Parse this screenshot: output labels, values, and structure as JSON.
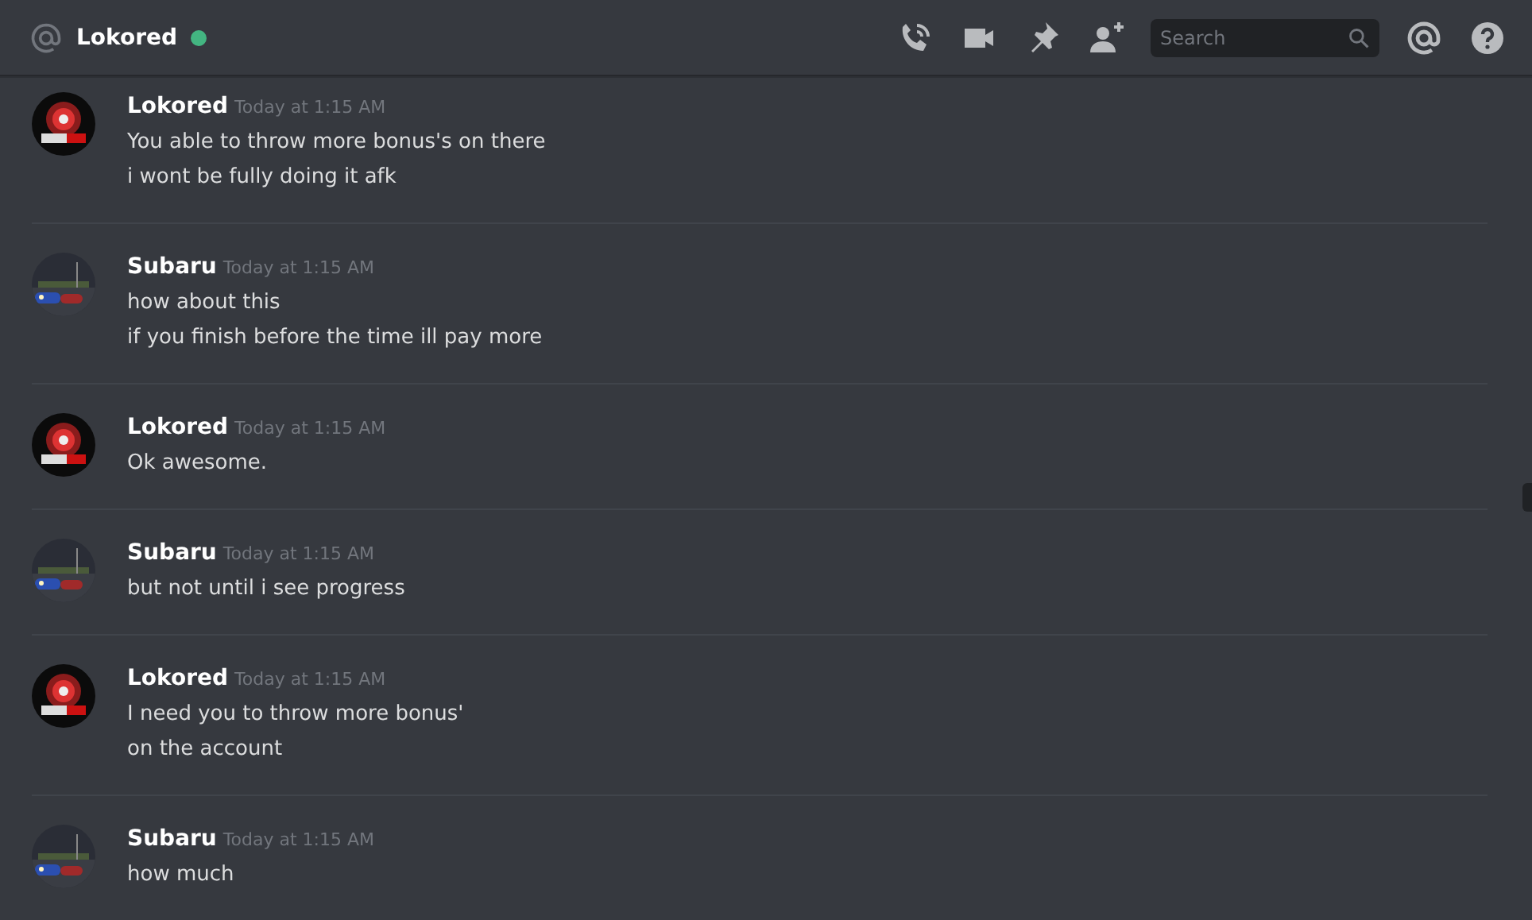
{
  "header": {
    "title": "Lokored",
    "online": true,
    "search": {
      "placeholder": "Search"
    }
  },
  "messages": [
    {
      "author": "Lokored",
      "kind": "logo",
      "time": "Today at 1:15 AM",
      "lines": [
        "You able to throw more bonus's on there",
        "i wont be fully doing it afk"
      ]
    },
    {
      "author": "Subaru",
      "time": "Today at 1:15 AM",
      "lines": [
        "how about this",
        "if you finish before the time ill pay more"
      ]
    },
    {
      "author": "Lokored",
      "kind": "logo",
      "time": "Today at 1:15 AM",
      "lines": [
        "Ok awesome."
      ]
    },
    {
      "author": "Subaru",
      "time": "Today at 1:15 AM",
      "lines": [
        "but not until i see progress"
      ]
    },
    {
      "author": "Lokored",
      "kind": "logo",
      "time": "Today at 1:15 AM",
      "lines": [
        "I need you to throw more bonus'",
        "on the account"
      ]
    },
    {
      "author": "Subaru",
      "time": "Today at 1:15 AM",
      "lines": [
        "how much"
      ]
    }
  ]
}
